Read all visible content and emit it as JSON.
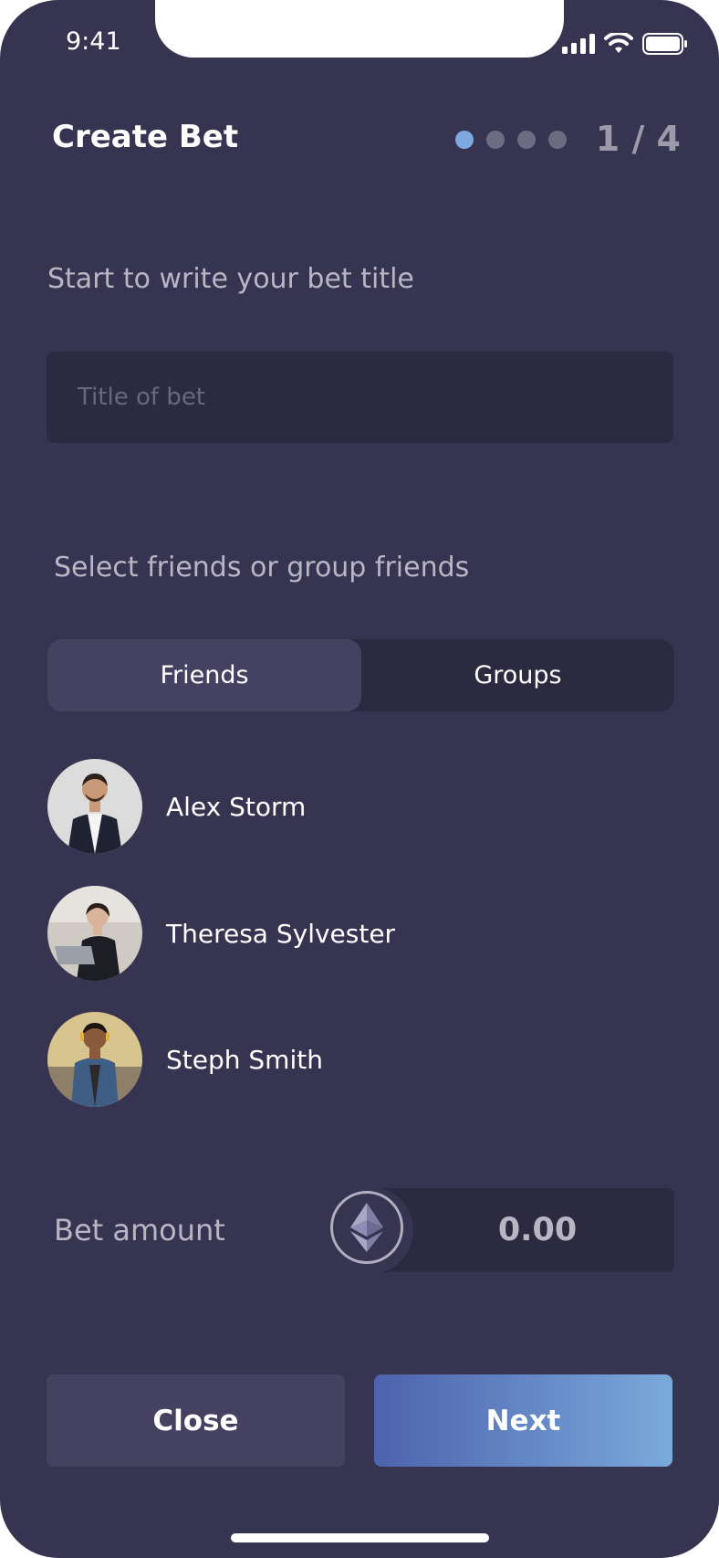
{
  "status": {
    "time": "9:41"
  },
  "header": {
    "title": "Create Bet",
    "step": "1 / 4",
    "total_steps": 4,
    "current_step": 1
  },
  "title_section": {
    "label": "Start to write your bet title",
    "placeholder": "Title of bet",
    "value": ""
  },
  "friends_section": {
    "label": "Select friends or group friends",
    "tabs": [
      {
        "label": "Friends",
        "active": true
      },
      {
        "label": "Groups",
        "active": false
      }
    ],
    "friends": [
      {
        "name": "Alex Storm"
      },
      {
        "name": "Theresa Sylvester"
      },
      {
        "name": "Steph Smith"
      }
    ]
  },
  "amount": {
    "label": "Bet amount",
    "value": "0.00",
    "currency_icon": "ethereum-icon"
  },
  "actions": {
    "close_label": "Close",
    "next_label": "Next"
  },
  "colors": {
    "background": "#363451",
    "field": "#2b2a40",
    "accent": "#7ea8e0",
    "next_gradient_start": "#4d63ac",
    "next_gradient_end": "#7aa9dc"
  }
}
